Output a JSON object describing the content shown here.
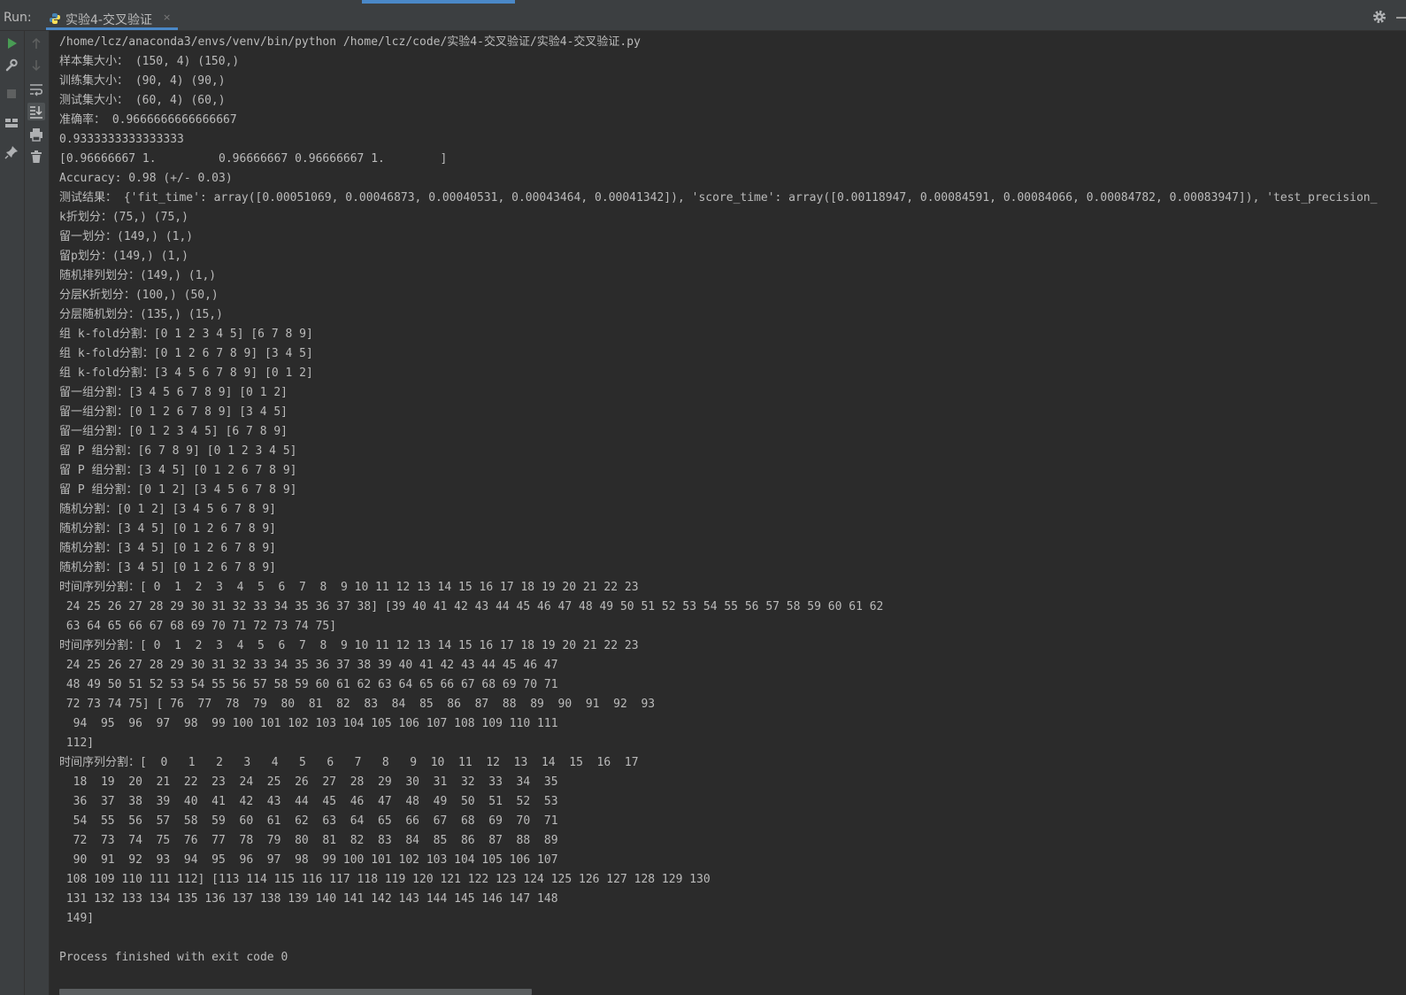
{
  "header": {
    "run_label": "Run:",
    "tab_title": "实验4-交叉验证",
    "tab_close": "×"
  },
  "colors": {
    "background": "#2b2b2b",
    "panel": "#3c3f41",
    "text": "#bbbbbb",
    "run_green": "#499c54",
    "accent_blue": "#4a88c7"
  },
  "toolbar": {
    "outer": [
      "run-icon",
      "wrench-icon",
      "stop-icon",
      "layout-icon",
      "pin-icon"
    ],
    "inner": [
      "up-arrow-icon",
      "down-arrow-icon",
      "soft-wrap-icon",
      "scroll-to-end-icon",
      "print-icon",
      "trash-icon"
    ]
  },
  "console": {
    "lines": [
      "/home/lcz/anaconda3/envs/venv/bin/python /home/lcz/code/实验4-交叉验证/实验4-交叉验证.py",
      "样本集大小： (150, 4) (150,)",
      "训练集大小： (90, 4) (90,)",
      "测试集大小： (60, 4) (60,)",
      "准确率： 0.9666666666666667",
      "0.9333333333333333",
      "[0.96666667 1.         0.96666667 0.96666667 1.        ]",
      "Accuracy: 0.98 (+/- 0.03)",
      "测试结果： {'fit_time': array([0.00051069, 0.00046873, 0.00040531, 0.00043464, 0.00041342]), 'score_time': array([0.00118947, 0.00084591, 0.00084066, 0.00084782, 0.00083947]), 'test_precision_",
      "k折划分：(75,) (75,)",
      "留一划分：(149,) (1,)",
      "留p划分：(149,) (1,)",
      "随机排列划分：(149,) (1,)",
      "分层K折划分：(100,) (50,)",
      "分层随机划分：(135,) (15,)",
      "组 k-fold分割：[0 1 2 3 4 5] [6 7 8 9]",
      "组 k-fold分割：[0 1 2 6 7 8 9] [3 4 5]",
      "组 k-fold分割：[3 4 5 6 7 8 9] [0 1 2]",
      "留一组分割：[3 4 5 6 7 8 9] [0 1 2]",
      "留一组分割：[0 1 2 6 7 8 9] [3 4 5]",
      "留一组分割：[0 1 2 3 4 5] [6 7 8 9]",
      "留 P 组分割：[6 7 8 9] [0 1 2 3 4 5]",
      "留 P 组分割：[3 4 5] [0 1 2 6 7 8 9]",
      "留 P 组分割：[0 1 2] [3 4 5 6 7 8 9]",
      "随机分割：[0 1 2] [3 4 5 6 7 8 9]",
      "随机分割：[3 4 5] [0 1 2 6 7 8 9]",
      "随机分割：[3 4 5] [0 1 2 6 7 8 9]",
      "随机分割：[3 4 5] [0 1 2 6 7 8 9]",
      "时间序列分割：[ 0  1  2  3  4  5  6  7  8  9 10 11 12 13 14 15 16 17 18 19 20 21 22 23",
      " 24 25 26 27 28 29 30 31 32 33 34 35 36 37 38] [39 40 41 42 43 44 45 46 47 48 49 50 51 52 53 54 55 56 57 58 59 60 61 62",
      " 63 64 65 66 67 68 69 70 71 72 73 74 75]",
      "时间序列分割：[ 0  1  2  3  4  5  6  7  8  9 10 11 12 13 14 15 16 17 18 19 20 21 22 23",
      " 24 25 26 27 28 29 30 31 32 33 34 35 36 37 38 39 40 41 42 43 44 45 46 47",
      " 48 49 50 51 52 53 54 55 56 57 58 59 60 61 62 63 64 65 66 67 68 69 70 71",
      " 72 73 74 75] [ 76  77  78  79  80  81  82  83  84  85  86  87  88  89  90  91  92  93",
      "  94  95  96  97  98  99 100 101 102 103 104 105 106 107 108 109 110 111",
      " 112]",
      "时间序列分割：[  0   1   2   3   4   5   6   7   8   9  10  11  12  13  14  15  16  17",
      "  18  19  20  21  22  23  24  25  26  27  28  29  30  31  32  33  34  35",
      "  36  37  38  39  40  41  42  43  44  45  46  47  48  49  50  51  52  53",
      "  54  55  56  57  58  59  60  61  62  63  64  65  66  67  68  69  70  71",
      "  72  73  74  75  76  77  78  79  80  81  82  83  84  85  86  87  88  89",
      "  90  91  92  93  94  95  96  97  98  99 100 101 102 103 104 105 106 107",
      " 108 109 110 111 112] [113 114 115 116 117 118 119 120 121 122 123 124 125 126 127 128 129 130",
      " 131 132 133 134 135 136 137 138 139 140 141 142 143 144 145 146 147 148",
      " 149]",
      "",
      "Process finished with exit code 0"
    ]
  }
}
